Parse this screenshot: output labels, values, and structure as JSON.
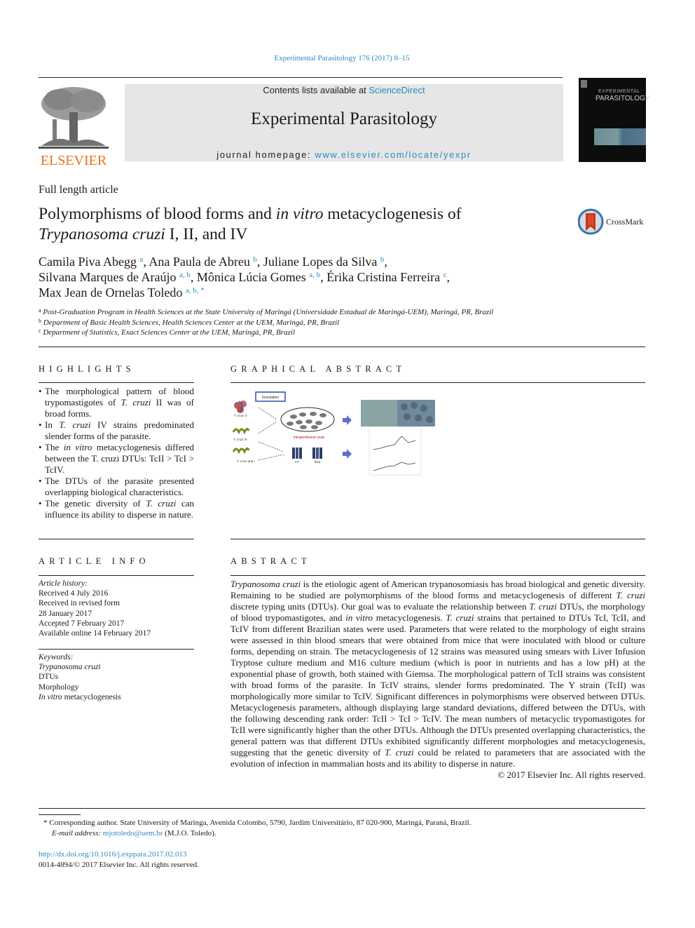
{
  "header": {
    "citation": "Experimental Parasitology 176 (2017) 8–15",
    "publisher_logo_text": "ELSEVIER",
    "contents_prefix": "Contents lists available at ",
    "contents_link": "ScienceDirect",
    "journal_title": "Experimental Parasitology",
    "homepage_prefix": "journal homepage: ",
    "homepage_link": "www.elsevier.com/locate/yexpr",
    "cover_small_title": "EXPERIMENTAL",
    "cover_title": "PARASITOLOGY"
  },
  "article": {
    "type": "Full length article",
    "title_part1": "Polymorphisms of blood forms and ",
    "title_italic1": "in vitro",
    "title_part2": " metacyclogenesis of",
    "title_italic2": "Trypanosoma cruzi",
    "title_part3": " I, II, and IV",
    "crossmark_label": "CrossMark"
  },
  "authors": [
    {
      "name": "Camila Piva Abegg",
      "aff": "a",
      "sep": ", "
    },
    {
      "name": "Ana Paula de Abreu",
      "aff": "b",
      "sep": ", "
    },
    {
      "name": "Juliane Lopes da Silva",
      "aff": "b",
      "sep": ","
    },
    {
      "name": "Silvana Marques de Araújo",
      "aff": "a, b",
      "sep": ", "
    },
    {
      "name": "Mônica Lúcia Gomes",
      "aff": "a, b",
      "sep": ", "
    },
    {
      "name": "Érika Cristina Ferreira",
      "aff": "c",
      "sep": ","
    },
    {
      "name": "Max Jean de Ornelas Toledo",
      "aff": "a, b, *",
      "sep": ""
    }
  ],
  "affiliations": [
    {
      "key": "a",
      "text": "Post-Graduation Program in Health Sciences at the State University of Maringá (Universidade Estadual de Maringá-UEM), Maringá, PR, Brazil"
    },
    {
      "key": "b",
      "text": "Department of Basic Health Sciences, Health Sciences Center at the UEM, Maringá, PR, Brazil"
    },
    {
      "key": "c",
      "text": "Department of Statistics, Exact Sciences Center at the UEM, Maringá, PR, Brazil"
    }
  ],
  "highlights": {
    "heading": "HIGHLIGHTS",
    "items": [
      {
        "pre": "The morphological pattern of blood trypomastigotes of ",
        "it": "T. cruzi",
        "post": " II was of broad forms."
      },
      {
        "pre": "In ",
        "it": "T. cruzi",
        "post": " IV strains predominated slender forms of the parasite."
      },
      {
        "pre": "The ",
        "it": "in vitro",
        "post": " metacyclogenesis differed between the T. cruzi DTUs: TcII > TcI > TcIV."
      },
      {
        "pre": "The DTUs of the parasite presented overlapping biological characteristics.",
        "it": "",
        "post": ""
      },
      {
        "pre": "The genetic diversity of ",
        "it": "T. cruzi",
        "post": " can influence its ability to disperse in nature."
      }
    ]
  },
  "graphical_abstract": {
    "heading": "GRAPHICAL ABSTRACT",
    "labels": {
      "inoculation": "Inoculation",
      "strain1": "T. cruzi II",
      "strain2": "T. cruzi IV",
      "strain3": "T. cruzi and I",
      "route": "Intraperitoneal route",
      "medium1": "LIT",
      "medium2": "M16"
    }
  },
  "article_info": {
    "heading": "ARTICLE INFO",
    "history_label": "Article history:",
    "history": [
      "Received 4 July 2016",
      "Received in revised form",
      "28 January 2017",
      "Accepted 7 February 2017",
      "Available online 14 February 2017"
    ],
    "keywords_label": "Keywords:",
    "keywords": [
      {
        "it": "Trypanosoma cruzi",
        "text": ""
      },
      {
        "it": "",
        "text": "DTUs"
      },
      {
        "it": "",
        "text": "Morphology"
      },
      {
        "it": "In vitro",
        "text": " metacyclogenesis"
      }
    ]
  },
  "abstract": {
    "heading": "ABSTRACT",
    "segments": [
      {
        "it": true,
        "t": "Trypanosoma cruzi"
      },
      {
        "it": false,
        "t": " is the etiologic agent of American trypanosomiasis has broad biological and genetic diversity. Remaining to be studied are polymorphisms of the blood forms and metacyclogenesis of different "
      },
      {
        "it": true,
        "t": "T. cruzi"
      },
      {
        "it": false,
        "t": " discrete typing units (DTUs). Our goal was to evaluate the relationship between "
      },
      {
        "it": true,
        "t": "T. cruzi"
      },
      {
        "it": false,
        "t": " DTUs, the morphology of blood trypomastigotes, and "
      },
      {
        "it": true,
        "t": "in vitro"
      },
      {
        "it": false,
        "t": " metacyclogenesis. "
      },
      {
        "it": true,
        "t": "T. cruzi"
      },
      {
        "it": false,
        "t": " strains that pertained to DTUs TcI, TcII, and TcIV from different Brazilian states were used. Parameters that were related to the morphology of eight strains were assessed in thin blood smears that were obtained from mice that were inoculated with blood or culture forms, depending on strain. The metacyclogenesis of 12 strains was measured using smears with Liver Infusion Tryptose culture medium and M16 culture me­dium (which is poor in nutrients and has a low pH) at the exponential phase of growth, both stained with Giemsa. The morphological pattern of TcII strains was consistent with broad forms of the parasite. In TcIV strains, slender forms predominated. The Y strain (TcII) was morphologically more similar to TcIV. Sig­nificant differences in polymorphisms were observed between DTUs. Metacyclogenesis parameters, although displaying large standard deviations, differed between the DTUs, with the following descending rank order: TcII > TcI > TcIV. The mean numbers of metacyclic trypomastigotes for TcII were significantly higher than the other DTUs. Although the DTUs presented overlapping characteristics, the general pattern was that different DTUs exhibited significantly different morphologies and metacyclogenesis, suggesting that the genetic diversity of "
      },
      {
        "it": true,
        "t": "T. cruzi"
      },
      {
        "it": false,
        "t": " could be related to parameters that are associated with the evolution of infection in mammalian hosts and its ability to disperse in nature."
      }
    ],
    "copyright": "© 2017 Elsevier Inc. All rights reserved."
  },
  "footnote": {
    "star": "*",
    "corresponding": " Corresponding author. State University of Maringa, Avenida Colombo, 5790, Jardim Universitário, 87 020-900, Maringá, Paraná, Brazil.",
    "email_label": "E-mail address: ",
    "email": "mjotoledo@uem.br",
    "email_suffix": " (M.J.O. Toledo)."
  },
  "doi": {
    "link": "http://dx.doi.org/10.1016/j.exppara.2017.02.013",
    "issn": "0014-4894/© 2017 Elsevier Inc. All rights reserved."
  },
  "colors": {
    "link": "#2a8bbf",
    "elsevier_orange": "#e8741e",
    "banner_gray": "#e6e6e6"
  }
}
